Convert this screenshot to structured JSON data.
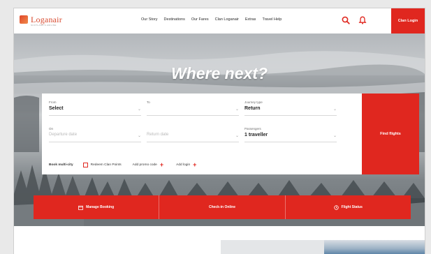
{
  "header": {
    "logo_text": "Loganair",
    "logo_subtext": "SCOTLAND'S AIRLINE",
    "nav": [
      "Our Story",
      "Destinations",
      "Our Fares",
      "Clan Loganair",
      "Extras",
      "Travel Help"
    ],
    "login_label": "Clan Login",
    "accent": "#e0271f"
  },
  "hero": {
    "title": "Where next?"
  },
  "search": {
    "from": {
      "label": "From",
      "value": "Select"
    },
    "to": {
      "label": "To",
      "placeholder": ""
    },
    "journey_type": {
      "label": "Journey type",
      "value": "Return"
    },
    "on": {
      "label": "On",
      "placeholder": "Departure date"
    },
    "return_date": {
      "placeholder": "Return date"
    },
    "passengers": {
      "label": "Passengers",
      "value": "1 traveller"
    },
    "book_multi_city": "Book multi-city",
    "redeem": "Redeem Clan Points",
    "promo": "Add promo code",
    "login": "Add login",
    "find_label": "Find flights"
  },
  "actions": [
    {
      "icon": "calendar-icon",
      "label": "Manage Booking"
    },
    {
      "icon": "",
      "label": "Check-in Online"
    },
    {
      "icon": "clock-icon",
      "label": "Flight Status"
    }
  ]
}
